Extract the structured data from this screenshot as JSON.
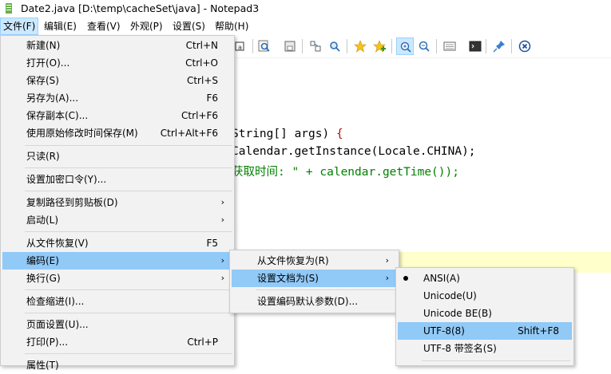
{
  "window": {
    "title": "Date2.java [D:\\temp\\cacheSet\\java] - Notepad3"
  },
  "menubar": [
    {
      "label": "文件(F)",
      "active": true
    },
    {
      "label": "编辑(E)"
    },
    {
      "label": "查看(V)"
    },
    {
      "label": "外观(P)"
    },
    {
      "label": "设置(S)"
    },
    {
      "label": "帮助(H)"
    }
  ],
  "toolbar_icons": [
    "toolbar-icon-partial",
    "find-icon",
    "save-all-icon",
    "wrap-icon",
    "find-next-icon",
    "star-icon",
    "star-add-icon",
    "zoom-in-icon",
    "zoom-out-icon",
    "view-icon",
    "console-icon",
    "pin-icon",
    "close-icon"
  ],
  "editor": {
    "lines": [
      [
        "String[] args) ",
        "{"
      ],
      [
        "Calendar.getInstance(Locale.CHINA);",
        ""
      ],
      [
        "获取时间: \" + calendar.getTime());",
        ""
      ]
    ]
  },
  "file_menu": {
    "items": [
      {
        "label": "新建(N)",
        "shortcut": "Ctrl+N"
      },
      {
        "label": "打开(O)...",
        "shortcut": "Ctrl+O"
      },
      {
        "label": "保存(S)",
        "shortcut": "Ctrl+S"
      },
      {
        "label": "另存为(A)...",
        "shortcut": "F6"
      },
      {
        "label": "保存副本(C)...",
        "shortcut": "Ctrl+F6"
      },
      {
        "label": "使用原始修改时间保存(M)",
        "shortcut": "Ctrl+Alt+F6"
      },
      {
        "label": "只读(R)",
        "shortcut": ""
      },
      {
        "label": "设置加密口令(Y)...",
        "shortcut": ""
      },
      {
        "label": "复制路径到剪贴板(D)",
        "shortcut": "",
        "submenu": true
      },
      {
        "label": "启动(L)",
        "shortcut": "",
        "submenu": true
      },
      {
        "label": "从文件恢复(V)",
        "shortcut": "F5"
      },
      {
        "label": "编码(E)",
        "shortcut": "",
        "submenu": true,
        "highlighted": true
      },
      {
        "label": "换行(G)",
        "shortcut": "",
        "submenu": true
      },
      {
        "label": "检查缩进(I)...",
        "shortcut": ""
      },
      {
        "label": "页面设置(U)...",
        "shortcut": ""
      },
      {
        "label": "打印(P)...",
        "shortcut": "Ctrl+P"
      },
      {
        "label": "属性(T)",
        "shortcut": ""
      }
    ]
  },
  "encoding_menu": {
    "items": [
      {
        "label": "从文件恢复为(R)",
        "submenu": true
      },
      {
        "label": "设置文档为(S)",
        "submenu": true,
        "highlighted": true
      },
      {
        "label": "设置编码默认参数(D)..."
      }
    ]
  },
  "doc_encoding_menu": {
    "items": [
      {
        "label": "ANSI(A)",
        "checked": true,
        "shortcut": ""
      },
      {
        "label": "Unicode(U)",
        "shortcut": ""
      },
      {
        "label": "Unicode BE(B)",
        "shortcut": ""
      },
      {
        "label": "UTF-8(8)",
        "shortcut": "Shift+F8",
        "highlighted": true
      },
      {
        "label": "UTF-8 带签名(S)",
        "shortcut": ""
      }
    ]
  },
  "colors": {
    "menu_highlight": "#91c9f7",
    "menu_bg": "#f2f2f2",
    "current_line": "#ffffcc",
    "string": "#008000"
  }
}
